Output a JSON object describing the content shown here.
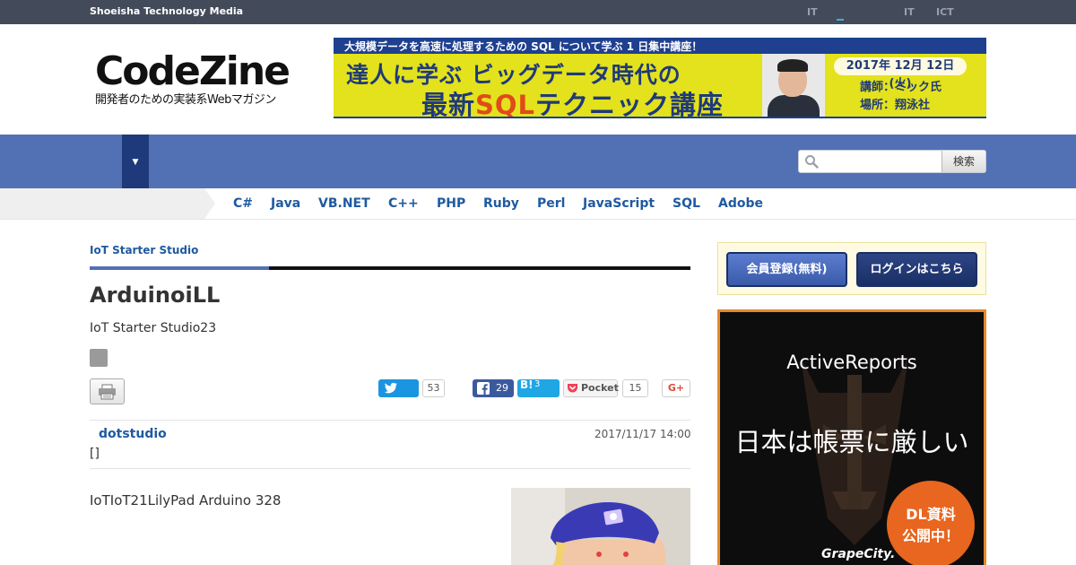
{
  "topbar": {
    "brand": "Shoeisha Technology Media",
    "links": [
      "IT",
      "IT",
      "ICT"
    ]
  },
  "logo": {
    "name": "CodeZine",
    "tagline": "開発者のための実装系Webマガジン"
  },
  "banner": {
    "top_line": "大規模データを高速に処理するための SQL について学ぶ 1 日集中講座！",
    "line1": "達人に学ぶ ビッグデータ時代の",
    "line2_pre": "最新",
    "line2_sql": "SQL",
    "line2_post": "テクニック講座",
    "date": "2017年 12月 12日 (火)",
    "speaker": "講師：ミック氏",
    "venue": "場所：翔泳社"
  },
  "search": {
    "placeholder": "",
    "button": "検索"
  },
  "languages": [
    "C#",
    "Java",
    "VB.NET",
    "C++",
    "PHP",
    "Ruby",
    "Perl",
    "JavaScript",
    "SQL",
    "Adobe"
  ],
  "article": {
    "category": "IoT Starter Studio",
    "title": "ArduinoiLL",
    "subtitle": "IoT Starter Studio23",
    "author": "dotstudio",
    "date": "2017/11/17 14:00",
    "brackets": "[]",
    "body": "IoTIoT21LilyPad Arduino 328"
  },
  "social": {
    "twitter_count": "53",
    "facebook_count": "29",
    "hatena_label": "B!",
    "hatena_count": "3",
    "pocket_label": "Pocket",
    "pocket_count": "15",
    "gplus_label": "G+"
  },
  "sidebar": {
    "register": "会員登録(無料)",
    "login": "ログインはこちら"
  },
  "ad": {
    "title": "ActiveReports",
    "main": "日本は帳票に厳しい",
    "circle_line1": "DL資料",
    "circle_line2": "公開中！",
    "brand": "GrapeCity."
  },
  "colors": {
    "topbar": "#434a59",
    "nav": "#5270b4",
    "accent_link": "#1f5aa0",
    "banner_yellow": "#e3e21c",
    "ad_orange": "#e8661f"
  }
}
